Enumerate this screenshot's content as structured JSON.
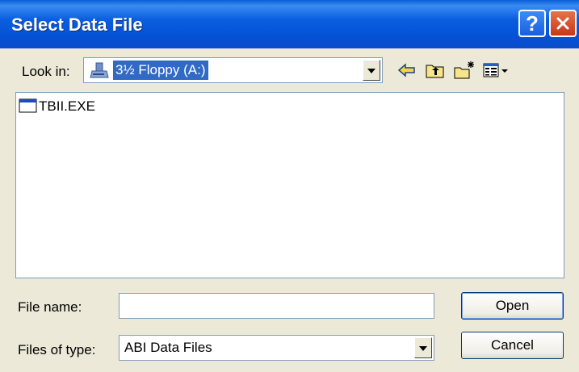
{
  "window": {
    "title": "Select Data File",
    "help_glyph": "?",
    "icons": [
      "help-icon",
      "close-icon"
    ]
  },
  "lookin": {
    "label": "Look in:",
    "value": "3½ Floppy (A:)",
    "icon": "floppy-drive-icon"
  },
  "toolbar": {
    "icons": [
      "back-arrow-icon",
      "up-folder-icon",
      "new-folder-icon",
      "view-menu-icon"
    ]
  },
  "files": [
    {
      "name": "TBII.EXE",
      "icon": "application-icon"
    }
  ],
  "filename": {
    "label": "File name:",
    "value": ""
  },
  "filetype": {
    "label": "Files of type:",
    "value": "ABI Data Files"
  },
  "buttons": {
    "open": "Open",
    "cancel": "Cancel"
  },
  "colors": {
    "titlebar": "#0551d6",
    "selection": "#316ac5",
    "dialog_bg": "#ece9d8"
  }
}
